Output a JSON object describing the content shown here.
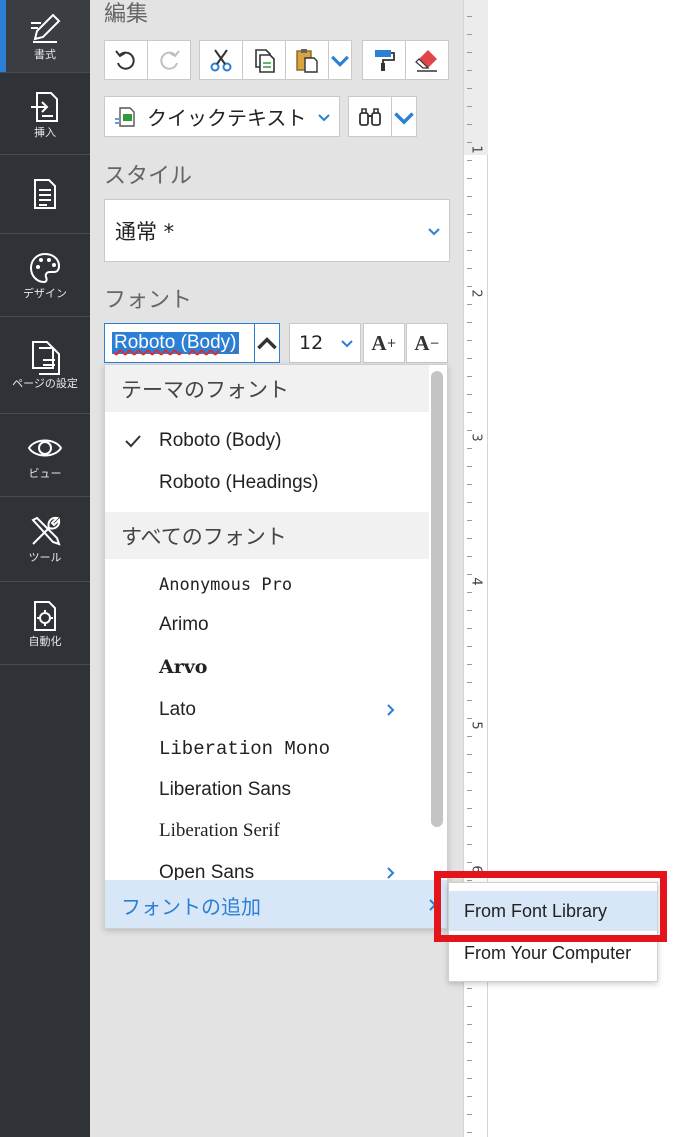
{
  "nav": {
    "items": [
      {
        "label": "書式",
        "icon": "format-icon",
        "active": true
      },
      {
        "label": "挿入",
        "icon": "insert-icon"
      },
      {
        "label": "",
        "icon": "document-icon"
      },
      {
        "label": "デザイン",
        "icon": "palette-icon"
      },
      {
        "label": "ページの設定",
        "icon": "page-setup-icon"
      },
      {
        "label": "ビュー",
        "icon": "eye-icon"
      },
      {
        "label": "ツール",
        "icon": "tools-icon"
      },
      {
        "label": "自動化",
        "icon": "automation-icon"
      }
    ]
  },
  "panel": {
    "edit_title": "編集",
    "quick_text_label": "クイックテキスト",
    "style_title": "スタイル",
    "style_value": "通常 *",
    "font_title": "フォント",
    "font_value": "Roboto (Body)",
    "font_size": "12",
    "grow_label": "A",
    "grow_sup": "+",
    "shrink_label": "A",
    "shrink_sup": "−"
  },
  "dropdown": {
    "theme_header": "テーマのフォント",
    "theme_fonts": [
      "Roboto (Body)",
      "Roboto (Headings)"
    ],
    "selected": "Roboto (Body)",
    "all_header": "すべてのフォント",
    "all_fonts": [
      "Anonymous Pro",
      "Arimo",
      "Arvo",
      "Lato",
      "Liberation Mono",
      "Liberation Sans",
      "Liberation Serif",
      "Open Sans"
    ],
    "add_font_label": "フォントの追加"
  },
  "submenu": {
    "items": [
      "From Font Library",
      "From Your Computer"
    ]
  },
  "ruler": {
    "numbers": [
      "1",
      "2",
      "3",
      "4",
      "5",
      "6"
    ]
  },
  "colors": {
    "accent": "#2b7fd4",
    "highlight": "#d8e7f7",
    "annotation": "#e4141b"
  }
}
